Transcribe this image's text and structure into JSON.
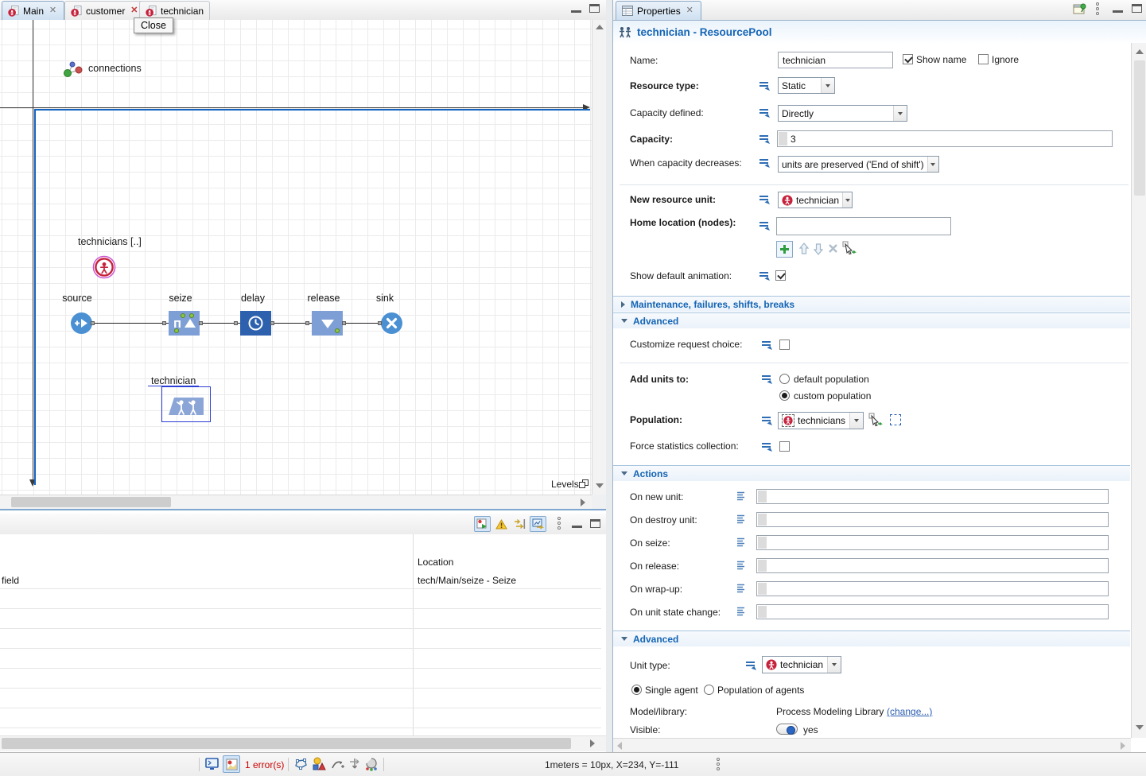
{
  "editor": {
    "tabs": [
      {
        "label": "Main"
      },
      {
        "label": "customer"
      },
      {
        "label": "technician"
      }
    ],
    "tooltip_close": "Close"
  },
  "canvas": {
    "connections_label": "connections",
    "population_label": "technicians [..]",
    "block_labels": {
      "source": "source",
      "seize": "seize",
      "delay": "delay",
      "release": "release",
      "sink": "sink"
    },
    "resource_pool_label": "technician",
    "levels_label": "Levels"
  },
  "problems": {
    "location_header": "Location",
    "row_description": "field",
    "row_location": "tech/Main/seize - Seize"
  },
  "properties": {
    "tab_label": "Properties",
    "title": "technician - ResourcePool",
    "name_label": "Name:",
    "name_value": "technician",
    "show_name_label": "Show name",
    "ignore_label": "Ignore",
    "resource_type_label": "Resource type:",
    "resource_type_value": "Static",
    "capacity_defined_label": "Capacity defined:",
    "capacity_defined_value": "Directly",
    "capacity_label": "Capacity:",
    "capacity_value": "3",
    "when_capacity_label": "When capacity decreases:",
    "when_capacity_value": "units are preserved ('End of shift')",
    "new_resource_unit_label": "New resource unit:",
    "new_resource_unit_value": "technician",
    "home_location_label": "Home location (nodes):",
    "home_location_value": "",
    "show_default_animation_label": "Show default animation:",
    "section_maintenance": "Maintenance, failures, shifts, breaks",
    "section_advanced1": "Advanced",
    "section_actions": "Actions",
    "section_advanced2": "Advanced",
    "customize_request_label": "Customize request choice:",
    "add_units_label": "Add units to:",
    "default_population_label": "default population",
    "custom_population_label": "custom population",
    "population_label": "Population:",
    "population_value": "technicians",
    "force_stats_label": "Force statistics collection:",
    "actions": [
      {
        "label": "On new unit:"
      },
      {
        "label": "On destroy unit:"
      },
      {
        "label": "On seize:"
      },
      {
        "label": "On release:"
      },
      {
        "label": "On wrap-up:"
      },
      {
        "label": "On unit state change:"
      }
    ],
    "unit_type_label": "Unit type:",
    "unit_type_value": "technician",
    "single_agent_label": "Single agent",
    "population_agents_label": "Population of agents",
    "model_library_label": "Model/library:",
    "model_library_value": "Process Modeling Library",
    "change_link_label": "(change...)",
    "visible_label": "Visible:",
    "visible_value": "yes"
  },
  "statusbar": {
    "errors": "1 error(s)",
    "scale_info": "1meters = 10px, X=234, Y=-111"
  },
  "colors": {
    "accent_blue": "#1464b4",
    "agent_red": "#c6223c",
    "block_light_blue": "#7e9fd6",
    "block_dark_blue": "#2d61ae",
    "node_blue": "#4a90d2",
    "state_green": "#8cc63f",
    "error_red": "#cc0000",
    "selection_magenta": "#c94fd0",
    "selection_blue": "#2b3fd4"
  },
  "icons": {
    "agent": "red-circle-person",
    "resource_pool": "two-persons-banner",
    "dynamic_param": "equals-with-arrow",
    "code_action": "list-lines",
    "warning": "triangle-exclamation"
  }
}
